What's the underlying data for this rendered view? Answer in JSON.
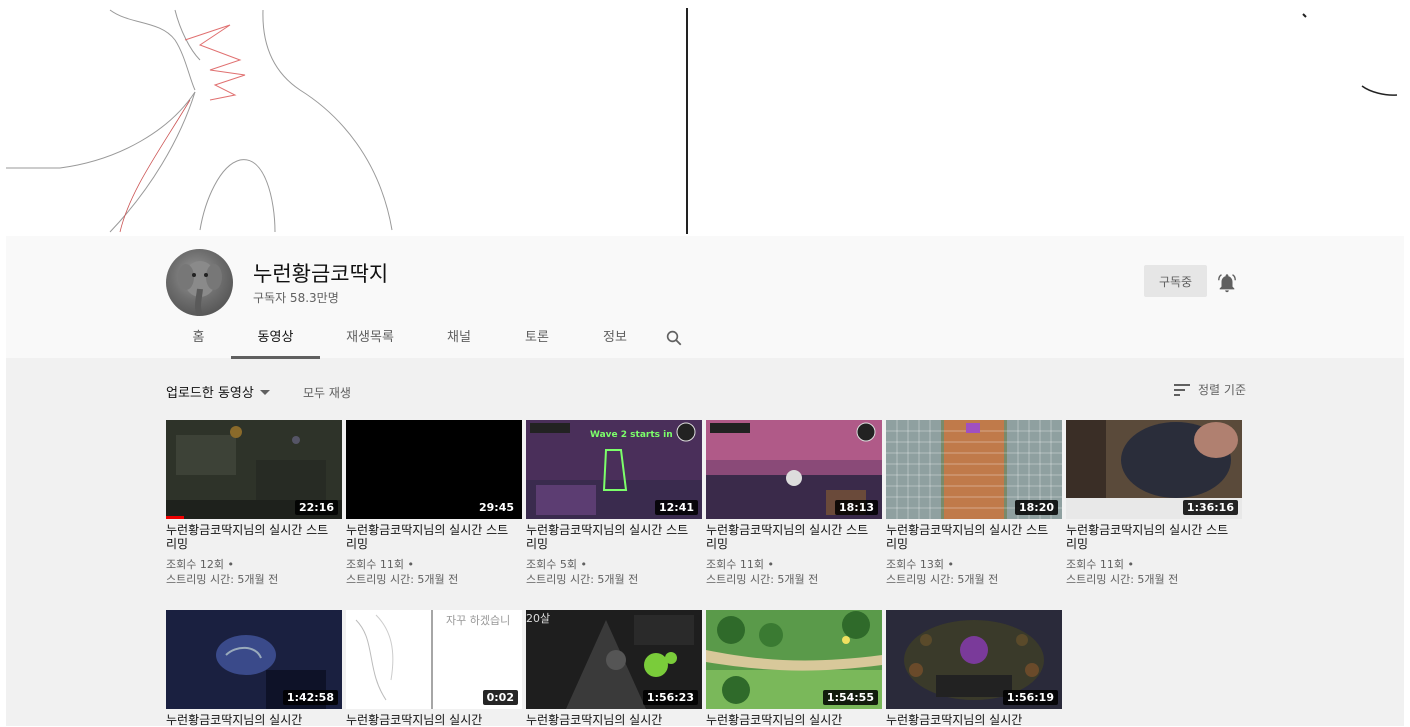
{
  "channel": {
    "name": "누런황금코딱지",
    "subscribers": "구독자 58.3만명",
    "subscribe_label": "구독중"
  },
  "tabs": [
    {
      "label": "홈",
      "active": false
    },
    {
      "label": "동영상",
      "active": true
    },
    {
      "label": "재생목록",
      "active": false
    },
    {
      "label": "채널",
      "active": false
    },
    {
      "label": "토론",
      "active": false
    },
    {
      "label": "정보",
      "active": false
    }
  ],
  "toolbar": {
    "uploads_label": "업로드한 동영상",
    "play_all_label": "모두 재생",
    "sort_label": "정렬 기준"
  },
  "videos": [
    {
      "title": "누런황금코딱지님의 실시간 스트리밍",
      "duration": "22:16",
      "views": "조회수 12회 •",
      "time": "스트리밍 시간: 5개월 전",
      "thumb": "game-dark",
      "watched": 0.1
    },
    {
      "title": "누런황금코딱지님의 실시간 스트리밍",
      "duration": "29:45",
      "views": "조회수 11회 •",
      "time": "스트리밍 시간: 5개월 전",
      "thumb": "black"
    },
    {
      "title": "누런황금코딱지님의 실시간 스트리밍",
      "duration": "12:41",
      "views": "조회수 5회 •",
      "time": "스트리밍 시간: 5개월 전",
      "thumb": "splatoon-purple",
      "overlay": "Wave 2 starts in"
    },
    {
      "title": "누런황금코딱지님의 실시간 스트리밍",
      "duration": "18:13",
      "views": "조회수 11회 •",
      "time": "스트리밍 시간: 5개월 전",
      "thumb": "splatoon-dusk"
    },
    {
      "title": "누런황금코딱지님의 실시간 스트리밍",
      "duration": "18:20",
      "views": "조회수 13회 •",
      "time": "스트리밍 시간: 5개월 전",
      "thumb": "puzzle-grid"
    },
    {
      "title": "누런황금코딱지님의 실시간 스트리밍",
      "duration": "1:36:16",
      "views": "조회수 11회 •",
      "time": "스트리밍 시간: 5개월 전",
      "thumb": "webcam"
    },
    {
      "title": "누런황금코딱지님의 실시간",
      "duration": "1:42:58",
      "thumb": "blue-dark"
    },
    {
      "title": "누런황금코딱지님의 실시간",
      "duration": "0:02",
      "thumb": "sketch",
      "overlay": "자꾸 하겠습니"
    },
    {
      "title": "누런황금코딱지님의 실시간",
      "duration": "1:56:23",
      "thumb": "splatoon-green",
      "overlay": "20살"
    },
    {
      "title": "누런황금코딱지님의 실시간",
      "duration": "1:54:55",
      "thumb": "forest"
    },
    {
      "title": "누런황금코딱지님의 실시간",
      "duration": "1:56:19",
      "thumb": "dungeon"
    }
  ],
  "colors": {
    "header_bg": "#f9f9f9",
    "page_bg": "#f1f1f1",
    "progress": "#ee0000"
  }
}
